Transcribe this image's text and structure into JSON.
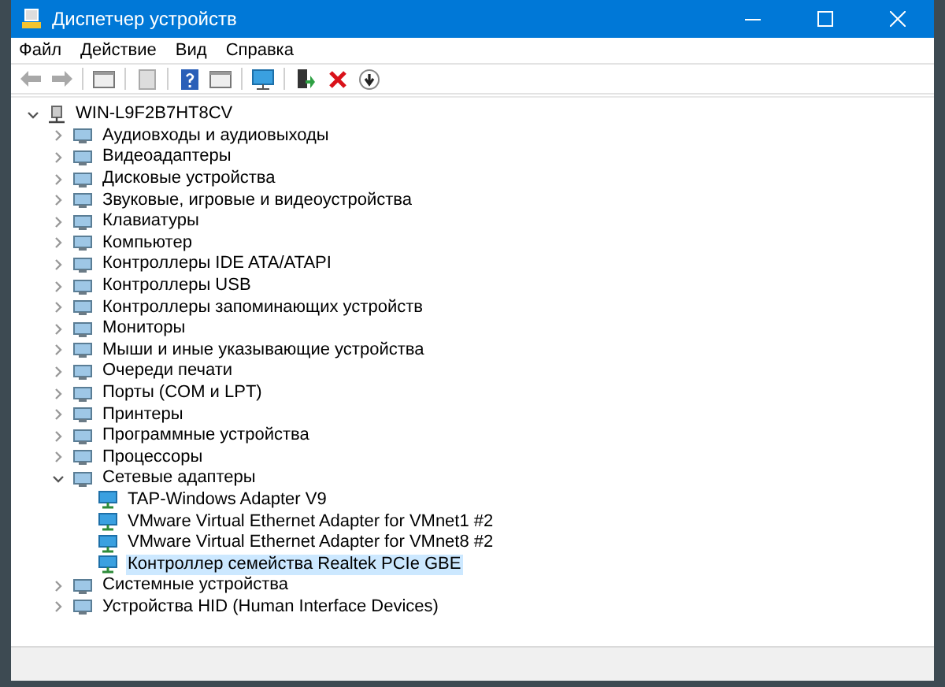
{
  "window": {
    "title": "Диспетчер устройств"
  },
  "menu": [
    {
      "label": "Файл"
    },
    {
      "label": "Действие"
    },
    {
      "label": "Вид"
    },
    {
      "label": "Справка"
    }
  ],
  "tree": {
    "label": "WIN-L9F2B7HT8CV",
    "expanded": true,
    "children": [
      {
        "label": "Аудиовходы и аудиовыходы",
        "expanded": false,
        "selected": false
      },
      {
        "label": "Видеоадаптеры",
        "expanded": false,
        "selected": false
      },
      {
        "label": "Дисковые устройства",
        "expanded": false,
        "selected": false
      },
      {
        "label": "Звуковые, игровые и видеоустройства",
        "expanded": false,
        "selected": false
      },
      {
        "label": "Клавиатуры",
        "expanded": false,
        "selected": false
      },
      {
        "label": "Компьютер",
        "expanded": false,
        "selected": false
      },
      {
        "label": "Контроллеры IDE ATA/ATAPI",
        "expanded": false,
        "selected": false
      },
      {
        "label": "Контроллеры USB",
        "expanded": false,
        "selected": false
      },
      {
        "label": "Контроллеры запоминающих устройств",
        "expanded": false,
        "selected": false
      },
      {
        "label": "Мониторы",
        "expanded": false,
        "selected": false
      },
      {
        "label": "Мыши и иные указывающие устройства",
        "expanded": false,
        "selected": false
      },
      {
        "label": "Очереди печати",
        "expanded": false,
        "selected": false
      },
      {
        "label": "Порты (COM и LPT)",
        "expanded": false,
        "selected": false
      },
      {
        "label": "Принтеры",
        "expanded": false,
        "selected": false
      },
      {
        "label": "Программные устройства",
        "expanded": false,
        "selected": false
      },
      {
        "label": "Процессоры",
        "expanded": false,
        "selected": false
      },
      {
        "label": "Сетевые адаптеры",
        "expanded": true,
        "selected": false,
        "children": [
          {
            "label": "TAP-Windows Adapter V9",
            "selected": false
          },
          {
            "label": "VMware Virtual Ethernet Adapter for VMnet1 #2",
            "selected": false
          },
          {
            "label": "VMware Virtual Ethernet Adapter for VMnet8 #2",
            "selected": false
          },
          {
            "label": "Контроллер семейства Realtek PCIe GBE",
            "selected": true
          }
        ]
      },
      {
        "label": "Системные устройства",
        "expanded": false,
        "selected": false
      },
      {
        "label": "Устройства HID (Human Interface Devices)",
        "expanded": false,
        "selected": false
      }
    ]
  }
}
